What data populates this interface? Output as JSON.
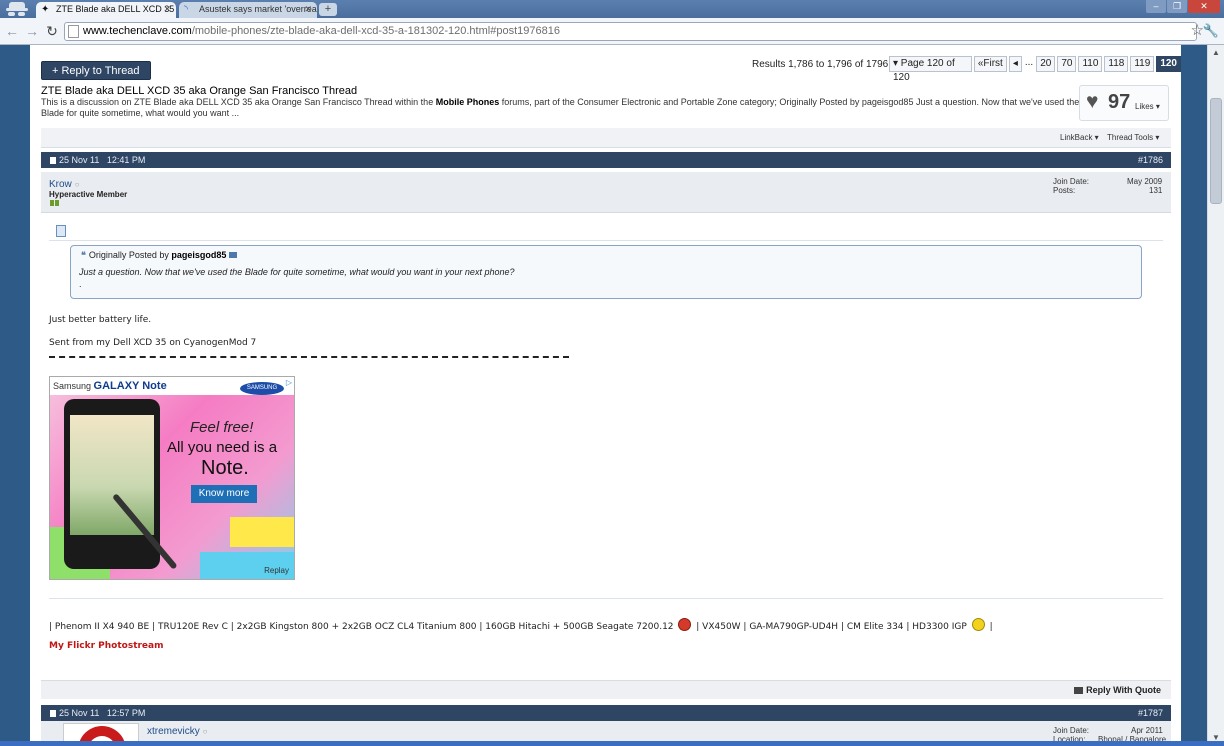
{
  "browser": {
    "tabs": [
      {
        "title": "ZTE Blade aka DELL XCD 35 ak",
        "active": true
      },
      {
        "title": "Asustek says market 'overrea",
        "active": false
      }
    ],
    "url_domain": "www.techenclave.com",
    "url_path": "/mobile-phones/zte-blade-aka-dell-xcd-35-a-181302-120.html#post1976816"
  },
  "thread": {
    "reply_button": "+ Reply to Thread",
    "results": "Results 1,786 to 1,796 of 1796",
    "pager": {
      "page_select": "▾ Page 120 of 120",
      "first": "«First",
      "prev": "◂",
      "dots": "...",
      "pages": [
        "20",
        "70",
        "110",
        "118",
        "119"
      ],
      "current": "120"
    },
    "title": "ZTE Blade aka DELL XCD 35 aka Orange San Francisco Thread",
    "desc_1": "This is a discussion on ZTE Blade aka DELL XCD 35 aka Orange San Francisco Thread within the ",
    "desc_forum": "Mobile Phones",
    "desc_2": " forums, part of the Consumer Electronic and Portable Zone category; Originally Posted by pageisgod85 Just a question. Now that we've used the Blade for quite sometime, what would you want ...",
    "likes_count": "97",
    "likes_label": "Likes ▾",
    "linkback": "LinkBack ▾",
    "thread_tools": "Thread Tools ▾"
  },
  "posts": [
    {
      "date": "25 Nov 11",
      "time": "12:41 PM",
      "number": "#1786",
      "username": "Krow",
      "online_dot": "○",
      "user_title": "Hyperactive Member",
      "join_label": "Join Date:",
      "join_date": "May 2009",
      "posts_label": "Posts:",
      "posts_count": "131",
      "quote_prefix": "Originally Posted by ",
      "quote_author": "pageisgod85",
      "quote_text": "Just a question. Now that we've used the Blade for quite sometime, what would you want in your next phone?",
      "quote_dot": ".",
      "message_1": "Just better battery life.",
      "message_2": "Sent from my Dell XCD 35 on CyanogenMod 7",
      "ad": {
        "brand_prefix": "Samsung",
        "brand_name": "GALAXY Note",
        "logo": "SAMSUNG",
        "line1": "Feel free!",
        "line2": "All you need is a",
        "line3": "Note.",
        "button": "Know more",
        "replay": "Replay"
      },
      "sig_1": "| Phenom II X4 940 BE | TRU120E Rev C | 2x2GB Kingston 800 + 2x2GB OCZ CL4 Titanium 800 | 160GB Hitachi + 500GB Seagate 7200.12",
      "sig_2": "| VX450W | GA-MA790GP-UD4H | CM Elite 334 | HD3300 IGP",
      "sig_3": "|",
      "flickr": "My Flickr Photostream",
      "reply_with_quote": "Reply With Quote"
    },
    {
      "date": "25 Nov 11",
      "time": "12:57 PM",
      "number": "#1787",
      "username": "xtremevicky",
      "online_dot": "○",
      "join_label": "Join Date:",
      "join_date": "Apr 2011",
      "location_label": "Location:",
      "location": "Bhopal / Bangalore"
    }
  ],
  "colors": {
    "header_navy": "#2e4564",
    "link_blue": "#1f4d8a",
    "flickr_red": "#c01616",
    "page_bg": "#2e5a87"
  }
}
